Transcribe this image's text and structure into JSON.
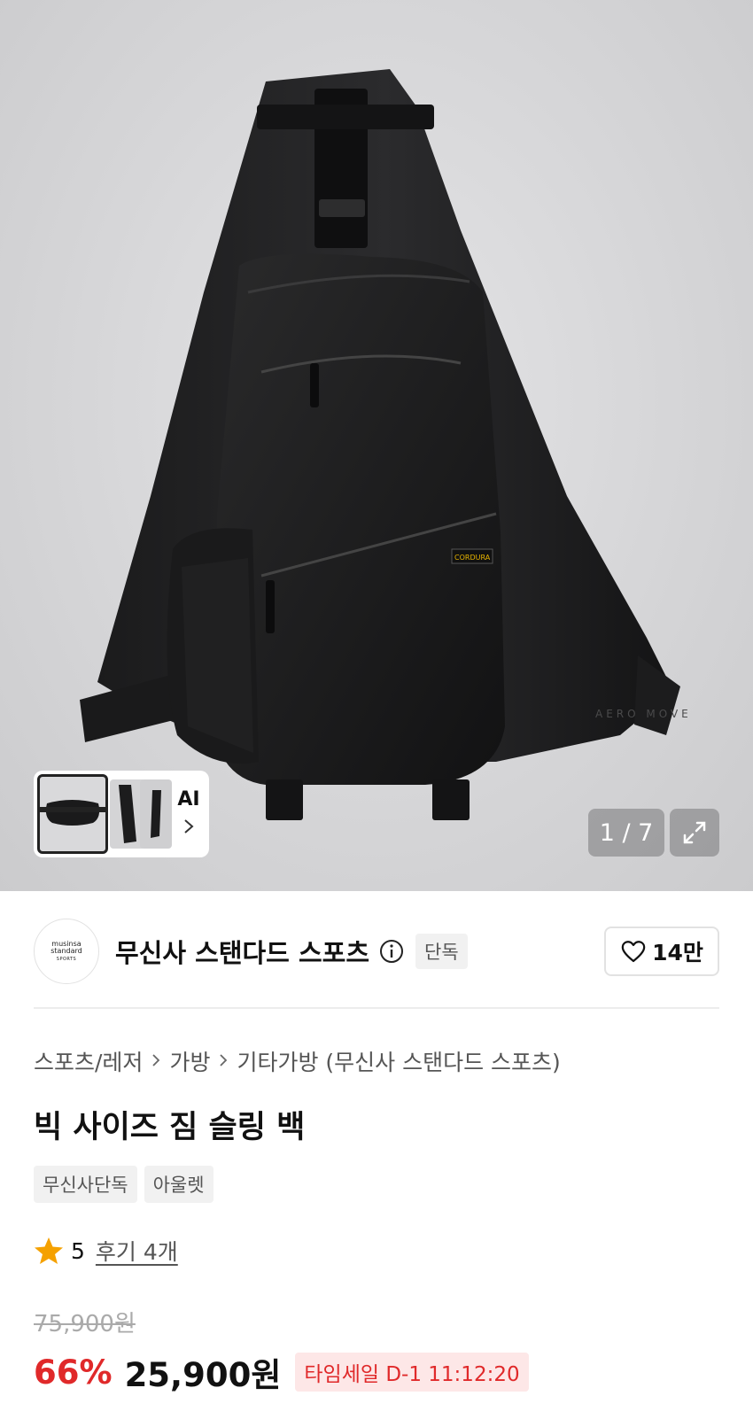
{
  "gallery": {
    "counter": "1 / 7",
    "ai_label": "AI",
    "print_text": "AERO MOVE",
    "cordura_text": "CORDURA"
  },
  "brand": {
    "logo_line1": "musinsa",
    "logo_line2": "standard",
    "logo_line3": "SPORTS",
    "name": "무신사 스탠다드 스포츠",
    "badge": "단독",
    "likes": "14만"
  },
  "product": {
    "breadcrumb": [
      "스포츠/레저",
      "가방",
      "기타가방 (무신사 스탠다드 스포츠)"
    ],
    "title": "빅 사이즈 짐 슬링 백",
    "tags": [
      "무신사단독",
      "아울렛"
    ],
    "rating": "5",
    "reviews": "후기 4개",
    "original_price": "75,900원",
    "discount": "66%",
    "price": "25,900원",
    "timesale": "타임세일 D-1 11:12:20"
  },
  "colors": {
    "accent_red": "#e0292a",
    "star": "#f5a100"
  }
}
